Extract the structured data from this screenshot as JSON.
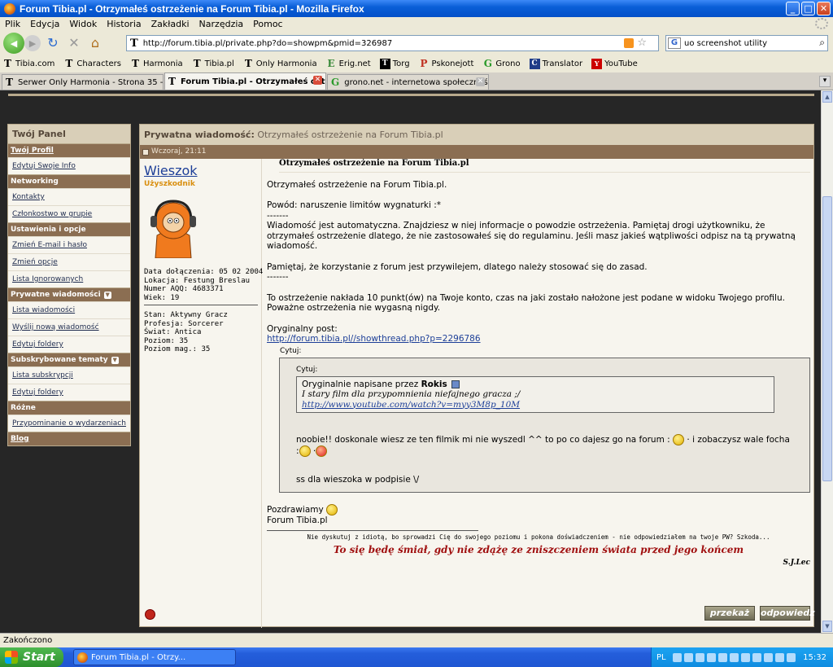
{
  "window": {
    "title": "Forum Tibia.pl - Otrzymałeś ostrzeżenie na Forum Tibia.pl - Mozilla Firefox"
  },
  "menu": [
    "Plik",
    "Edycja",
    "Widok",
    "Historia",
    "Zakładki",
    "Narzędzia",
    "Pomoc"
  ],
  "nav": {
    "url": "http://forum.tibia.pl/private.php?do=showpm&pmid=326987",
    "search_value": "uo screenshot utility"
  },
  "bookmarks": [
    {
      "label": "Tibia.com",
      "icon": "T"
    },
    {
      "label": "Characters",
      "icon": "T"
    },
    {
      "label": "Harmonia",
      "icon": "T"
    },
    {
      "label": "Tibia.pl",
      "icon": "T"
    },
    {
      "label": "Only Harmonia",
      "icon": "T"
    },
    {
      "label": "Erig.net",
      "icon": "E"
    },
    {
      "label": "Torg",
      "icon": "T"
    },
    {
      "label": "Pskonejott",
      "icon": "P"
    },
    {
      "label": "Grono",
      "icon": "G"
    },
    {
      "label": "Translator",
      "icon": "C"
    },
    {
      "label": "YouTube",
      "icon": "Y"
    }
  ],
  "tabs": [
    {
      "label": "Serwer Only Harmonia - Strona 35 - Fo..."
    },
    {
      "label": "Forum Tibia.pl - Otrzymałeś ostr..."
    },
    {
      "label": "grono.net - internetowa społeczność p..."
    }
  ],
  "panel": {
    "title": "Twój Panel",
    "items": [
      {
        "type": "sec",
        "label": "Twój Profil",
        "u": true
      },
      {
        "type": "link",
        "label": "Edytuj Swoje Info"
      },
      {
        "type": "sec",
        "label": "Networking"
      },
      {
        "type": "link",
        "label": "Kontakty"
      },
      {
        "type": "link",
        "label": "Członkostwo w grupie"
      },
      {
        "type": "sec",
        "label": "Ustawienia i opcje"
      },
      {
        "type": "link",
        "label": "Zmień E-mail i hasło"
      },
      {
        "type": "link",
        "label": "Zmień opcje"
      },
      {
        "type": "link",
        "label": "Lista Ignorowanych"
      },
      {
        "type": "sec",
        "label": "Prywatne wiadomości",
        "dd": true
      },
      {
        "type": "link",
        "label": "Lista wiadomości"
      },
      {
        "type": "link",
        "label": "Wyślij nową wiadomość"
      },
      {
        "type": "link",
        "label": "Edytuj foldery"
      },
      {
        "type": "sec",
        "label": "Subskrybowane tematy",
        "dd": true
      },
      {
        "type": "link",
        "label": "Lista subskrypcji"
      },
      {
        "type": "link",
        "label": "Edytuj foldery"
      },
      {
        "type": "sec",
        "label": "Różne"
      },
      {
        "type": "link",
        "label": "Przypominanie o wydarzeniach"
      },
      {
        "type": "sec",
        "label": "Blog",
        "u": true
      }
    ]
  },
  "message": {
    "header_bold": "Prywatna wiadomość:",
    "header_sub": "Otrzymałeś ostrzeżenie na Forum Tibia.pl",
    "date": "Wczoraj, 21:11",
    "subject": "Otrzymałeś ostrzeżenie na Forum Tibia.pl",
    "lines": {
      "l1": "Otrzymałeś ostrzeżenie na Forum Tibia.pl.",
      "l2": "Powód: naruszenie limitów wygnaturki :*",
      "dash1": "-------",
      "l3": "Wiadomość jest automatyczna. Znajdziesz w niej informacje o powodzie ostrzeżenia. Pamiętaj drogi użytkowniku, że otrzymałeś ostrzeżenie dlatego, że nie zastosowałeś się do regulaminu. Jeśli masz jakieś wątpliwości odpisz na tą prywatną wiadomość.",
      "l4": "Pamiętaj, że korzystanie z forum jest przywilejem, dlatego należy stosować się do zasad.",
      "dash2": "-------",
      "l5": "To ostrzeżenie nakłada 10 punkt(ów) na Twoje konto, czas na jaki zostało nałożone jest podane w widoku Twojego profilu. Poważne ostrzeżenia nie wygasną nigdy.",
      "orig_label": "Oryginalny post:",
      "orig_link": "http://forum.tibia.pl//showthread.php?p=2296786"
    },
    "quote": {
      "label": "Cytuj:",
      "inner_label": "Cytuj:",
      "inner_by": "Oryginalnie napisane przez",
      "inner_author": "Rokis",
      "inner_text": "I stary film dla przypomnienia niefajnego gracza ;/",
      "inner_link": "http://www.youtube.com/watch?v=myy3M8p_10M",
      "text1a": "noobie!! doskonale wiesz ze ten filmik mi nie wyszedl ^^ to po co dajesz go na forum :",
      "text1b": "· i zobaczysz wale focha",
      "text1c": ":",
      "text1d": "·",
      "text2": "ss dla wieszoka w podpisie \\/"
    },
    "closing1": "Pozdrawiamy",
    "closing2": "Forum Tibia.pl",
    "sig_small": "Nie dyskutuj z idiotą, bo sprowadzi Cię do swojego poziomu i pokona doświadczeniem - nie odpowiedziałem na twoje PW? Szkoda...",
    "sig_big": "To się będę śmiał, gdy nie zdążę ze zniszczeniem świata przed jego końcem",
    "sig_author": "S.J.Lec",
    "btn_forward": "przekaż",
    "btn_reply": "odpowiedz"
  },
  "user": {
    "name": "Wieszok",
    "rank": "Użyszkodnik",
    "info1": "Data dołączenia: 05 02 2004\nLokacja: Festung Breslau\nNumer AQQ: 4683371\nWiek: 19",
    "info2": "Stan: Aktywny Gracz\nProfesja: Sorcerer\nŚwiat: Antica\nPoziom: 35\nPoziom mag.: 35"
  },
  "status": "Zakończono",
  "taskbar": {
    "start": "Start",
    "item": "Forum Tibia.pl - Otrzy...",
    "lang": "PL",
    "clock": "15:32"
  }
}
